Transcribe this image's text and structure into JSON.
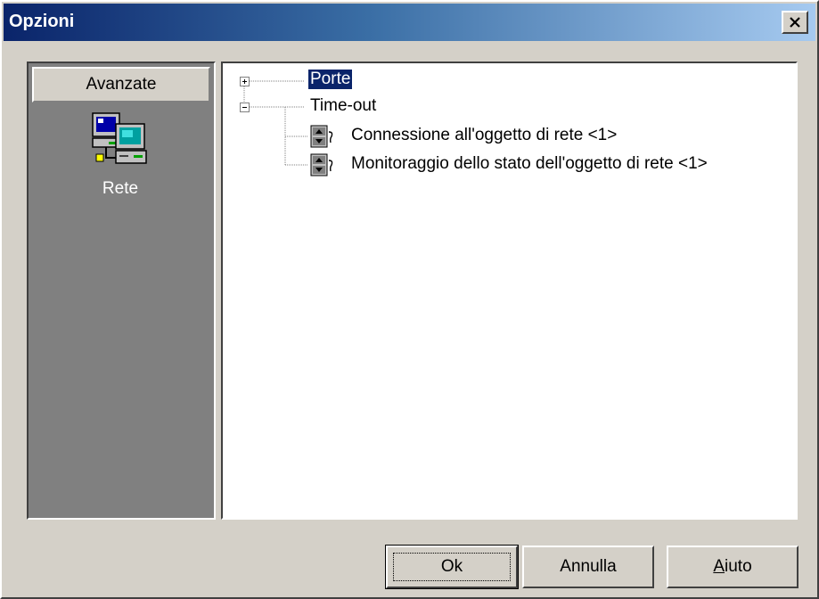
{
  "window": {
    "title": "Opzioni",
    "close_icon": "close-x-icon"
  },
  "sidebar": {
    "header": "Avanzate",
    "items": [
      {
        "label": "Rete",
        "icon": "network-computers-icon",
        "selected": true
      }
    ]
  },
  "tree": {
    "nodes": [
      {
        "label": "Porte",
        "expander": "+",
        "selected": true
      },
      {
        "label": "Time-out",
        "expander": "-",
        "children": [
          {
            "label": "Connessione all'oggetto di rete <1>",
            "icon": "spinner-setting-icon"
          },
          {
            "label": "Monitoraggio dello stato dell'oggetto di rete <1>",
            "icon": "spinner-setting-icon"
          }
        ]
      }
    ]
  },
  "buttons": {
    "ok": "Ok",
    "cancel": "Annulla",
    "help_first": "A",
    "help_rest": "iuto"
  },
  "colors": {
    "titlebar_start": "#0a246a",
    "titlebar_end": "#a6caf0",
    "dialog_face": "#d4d0c8",
    "selection": "#0a246a",
    "sidebar_bg": "#808080"
  }
}
